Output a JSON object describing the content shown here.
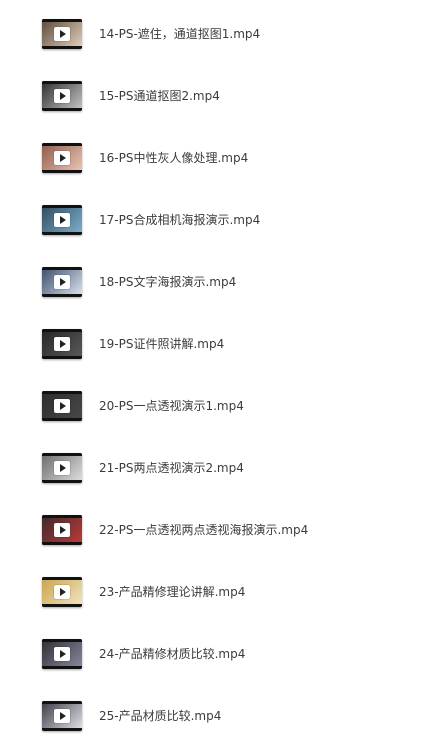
{
  "files": [
    {
      "name": "14-PS-遮住，通道抠图1.mp4",
      "icon": "video-thumbnail-icon",
      "bg": "#5a4a3a",
      "accent": "#e8d2c0"
    },
    {
      "name": "15-PS通道抠图2.mp4",
      "icon": "video-thumbnail-icon",
      "bg": "#2d2d2d",
      "accent": "#c9c9c9"
    },
    {
      "name": "16-PS中性灰人像处理.mp4",
      "icon": "video-thumbnail-icon",
      "bg": "#8a5a4a",
      "accent": "#f0c8b8"
    },
    {
      "name": "17-PS合成相机海报演示.mp4",
      "icon": "video-thumbnail-icon",
      "bg": "#2f4a5c",
      "accent": "#7fb3d1"
    },
    {
      "name": "18-PS文字海报演示.mp4",
      "icon": "video-thumbnail-icon",
      "bg": "#3a4c6a",
      "accent": "#dfe6f2"
    },
    {
      "name": "19-PS证件照讲解.mp4",
      "icon": "video-thumbnail-icon",
      "bg": "#262626",
      "accent": "#5a5a5a"
    },
    {
      "name": "20-PS一点透视演示1.mp4",
      "icon": "video-thumbnail-icon",
      "bg": "#2b2b2b",
      "accent": "#4a4a4a"
    },
    {
      "name": "21-PS两点透视演示2.mp4",
      "icon": "video-thumbnail-icon",
      "bg": "#6a6a6a",
      "accent": "#e2e2e2"
    },
    {
      "name": "22-PS一点透视两点透视海报演示.mp4",
      "icon": "video-thumbnail-icon",
      "bg": "#3a2a2a",
      "accent": "#c43a3a"
    },
    {
      "name": "23-产品精修理论讲解.mp4",
      "icon": "video-thumbnail-icon",
      "bg": "#c8a24a",
      "accent": "#f2e6c2"
    },
    {
      "name": "24-产品精修材质比较.mp4",
      "icon": "video-thumbnail-icon",
      "bg": "#2e2e36",
      "accent": "#8a8aa0"
    },
    {
      "name": "25-产品材质比较.mp4",
      "icon": "video-thumbnail-icon",
      "bg": "#3a3a44",
      "accent": "#e6e6ee"
    }
  ]
}
